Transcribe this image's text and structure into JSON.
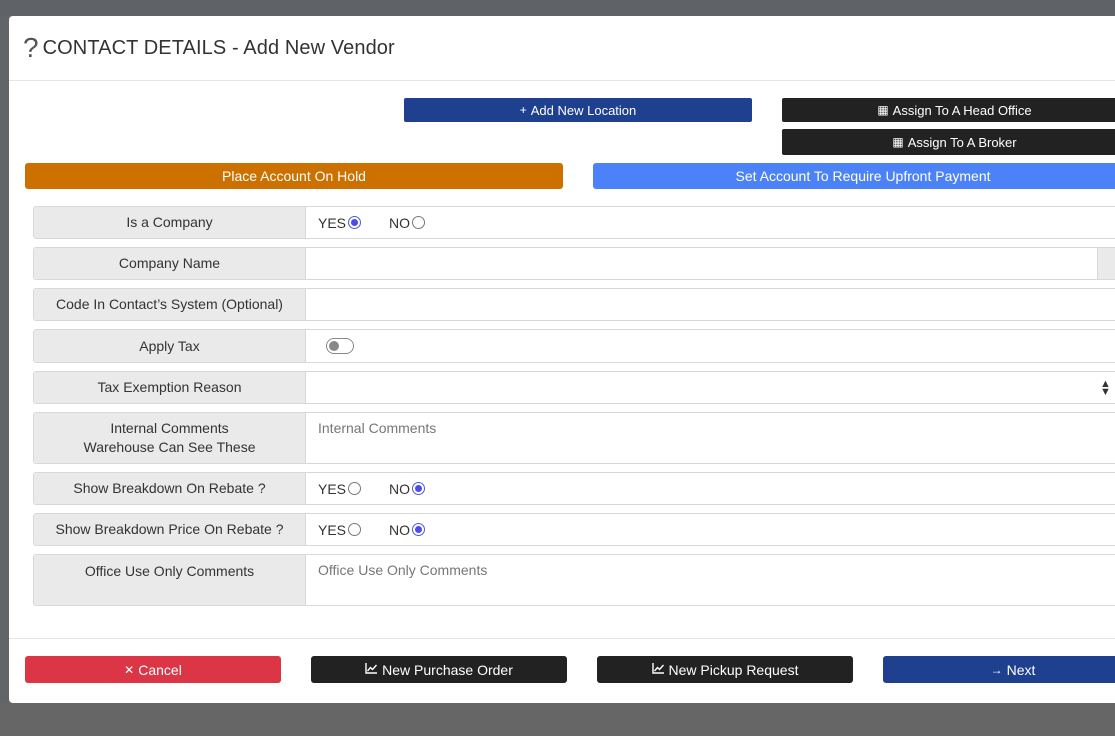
{
  "header": {
    "title": "CONTACT DETAILS - Add New Vendor",
    "help_glyph": "?"
  },
  "actions": {
    "add_location": "Add New Location",
    "assign_head_office": "Assign To A Head Office",
    "assign_broker": "Assign To A Broker",
    "place_on_hold": "Place Account On Hold",
    "require_upfront": "Set Account To Require Upfront Payment"
  },
  "form": {
    "is_company": {
      "label": "Is a Company",
      "yes": "YES",
      "no": "NO",
      "selected": "YES"
    },
    "company_name": {
      "label": "Company Name",
      "value": ""
    },
    "code_in_system": {
      "label": "Code In Contact’s System (Optional)",
      "value": ""
    },
    "apply_tax": {
      "label": "Apply Tax",
      "enabled": false
    },
    "tax_exemption": {
      "label": "Tax Exemption Reason",
      "value": ""
    },
    "internal_comments": {
      "label_line1": "Internal Comments",
      "label_line2": "Warehouse Can See These",
      "placeholder": "Internal Comments"
    },
    "breakdown_rebate": {
      "label": "Show Breakdown On Rebate ?",
      "yes": "YES",
      "no": "NO",
      "selected": "NO"
    },
    "breakdown_price_rebate": {
      "label": "Show Breakdown Price On Rebate ?",
      "yes": "YES",
      "no": "NO",
      "selected": "NO"
    },
    "office_comments": {
      "label": "Office Use Only Comments",
      "placeholder": "Office Use Only Comments"
    }
  },
  "footer": {
    "cancel": "Cancel",
    "new_po": "New Purchase Order",
    "new_pickup": "New Pickup Request",
    "next": "Next"
  },
  "colors": {
    "primary_navy": "#1f3f8f",
    "dark": "#222222",
    "hold_orange": "#cc7000",
    "upfront_blue": "#4c82f7",
    "cancel_red": "#dc3545",
    "radio_checked": "#4b4bf0"
  },
  "icons": {
    "add_location": "plus-icon",
    "head_office": "building-icon",
    "broker": "building-icon",
    "cancel": "close-icon",
    "new_po": "chart-icon",
    "new_pickup": "chart-icon",
    "next": "arrow-right-icon",
    "select": "sort-arrows-icon"
  }
}
